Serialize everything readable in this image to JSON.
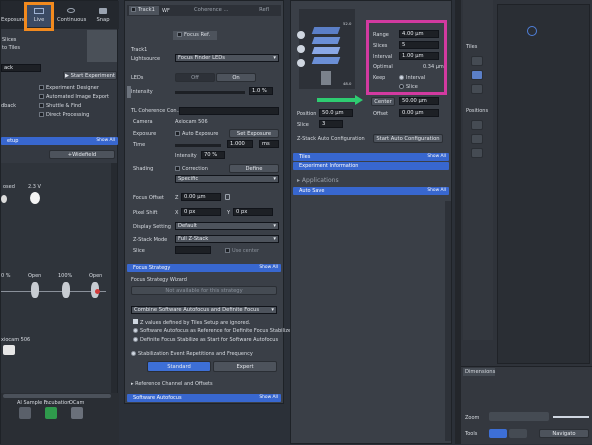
{
  "colors": {
    "accent": "#3867cf",
    "highlight_orange": "#f28a1e",
    "highlight_magenta": "#d23aa0",
    "arrow_green": "#2ecc71"
  },
  "left_panel": {
    "top_buttons": [
      {
        "label": "Exposure"
      },
      {
        "label": "Live"
      },
      {
        "label": "Continuous"
      },
      {
        "label": "Snap"
      }
    ],
    "slices_label": "Slices",
    "to_tiles_label": "to Tiles",
    "track_label": "ack",
    "start_experiment": "Start Experiment",
    "options": [
      "Experiment Designer",
      "Automated Image Export",
      "Shuttle & Find",
      "Direct Processing"
    ],
    "left_fragments": [
      "dback"
    ],
    "setup_bar": "etup",
    "show_all": "Show All",
    "widefield": "+Widefield",
    "labels_row1": [
      "osed",
      "2.3 V"
    ],
    "labels_row2": [
      "0 %",
      "Open",
      "100%",
      "Open"
    ],
    "camera": "xiocam 506",
    "bottom_tools": [
      "AI Sample F...",
      "Incubation",
      "OCam"
    ]
  },
  "mid_panel": {
    "track_tab": "Track1",
    "wf": "WF",
    "coherence_tab": "Coherence ...",
    "refl": "Refl",
    "focus_ref": "Focus Ref.",
    "track_heading": "Track1",
    "lightsource_label": "Lightsource",
    "lightsource_value": "Focus Finder LEDs",
    "leds_label": "LEDs",
    "off_label": "Off",
    "on_label": "On",
    "intensity_label": "Intensity",
    "intensity_value": "1.0 %",
    "tl_section": "TL Coherence Con...",
    "camera_label": "Camera",
    "camera_value": "Axiocam 506",
    "exposure_label": "Exposure",
    "auto_exposure": "Auto Exposure",
    "set_exposure": "Set Exposure",
    "time_label": "Time",
    "time_value": "1.000",
    "time_unit": "ms",
    "intensity2_label": "Intensity",
    "intensity2_value": "70 %",
    "shading_label": "Shading",
    "correction": "Correction",
    "define": "Define",
    "specific": "Specific",
    "focus_offset_label": "Focus Offset",
    "focus_offset_z": "Z",
    "focus_offset_value": "0.00 µm",
    "pixel_shift_label": "Pixel Shift",
    "px_x": "X",
    "px_x_value": "0 px",
    "px_y": "Y",
    "px_y_value": "0 px",
    "display_setting_label": "Display Setting",
    "display_setting_value": "Default",
    "zstack_mode_label": "Z-Stack Mode",
    "zstack_mode_value": "Full Z-Stack",
    "slice_label": "Slice",
    "use_center": "Use center",
    "focus_strategy_bar": "Focus Strategy",
    "show_all": "Show All",
    "wizard_label": "Focus Strategy Wizard",
    "not_available": "Not available for this strategy",
    "combine_value": "Combine Software Autofocus and Definite Focus",
    "z_values_note": "Z values defined by Tiles Setup are ignored.",
    "option_sw": "Software Autofocus as Reference for Definite Focus Stabilize",
    "option_df": "Definite Focus Stabilize as Start for Software Autofocus",
    "stabilization": "Stabilization Event Repetitions and Frequency",
    "standard": "Standard",
    "expert": "Expert",
    "ref_channel": "Reference Channel and Offsets",
    "software_autofocus_bar": "Software Autofocus"
  },
  "zstack_panel": {
    "range_label": "Range",
    "range_value": "4.00 µm",
    "slices_label": "Slices",
    "slices_value": "5",
    "interval_label": "Interval",
    "interval_value": "1.00 µm",
    "optimal_label": "Optimal",
    "optimal_value": "0.34 µm",
    "keep_label": "Keep",
    "keep_interval": "Interval",
    "keep_slice": "Slice",
    "center_button": "Center",
    "center_value": "50.00 µm",
    "position_label": "Position",
    "position_value": "50.0 µm",
    "offset_label": "Offset",
    "offset_value": "0.00 µm",
    "slice_label": "Slice",
    "slice_value": "3",
    "auto_config_label": "Z-Stack Auto Configuration",
    "start_auto_config": "Start Auto Configuration",
    "tiles_bar": "Tiles",
    "experiment_info_bar": "Experiment Information",
    "applications_label": "Applications",
    "auto_save_bar": "Auto Save",
    "show_all": "Show All",
    "stack_top": "52.0",
    "stack_bottom": "48.0"
  },
  "right_panel": {
    "tiles_label": "Tiles",
    "positions_label": "Positions",
    "dimensions_tab": "Dimensions",
    "zoom_label": "Zoom",
    "tools_label": "Tools",
    "navigator_label": "Navigato"
  }
}
